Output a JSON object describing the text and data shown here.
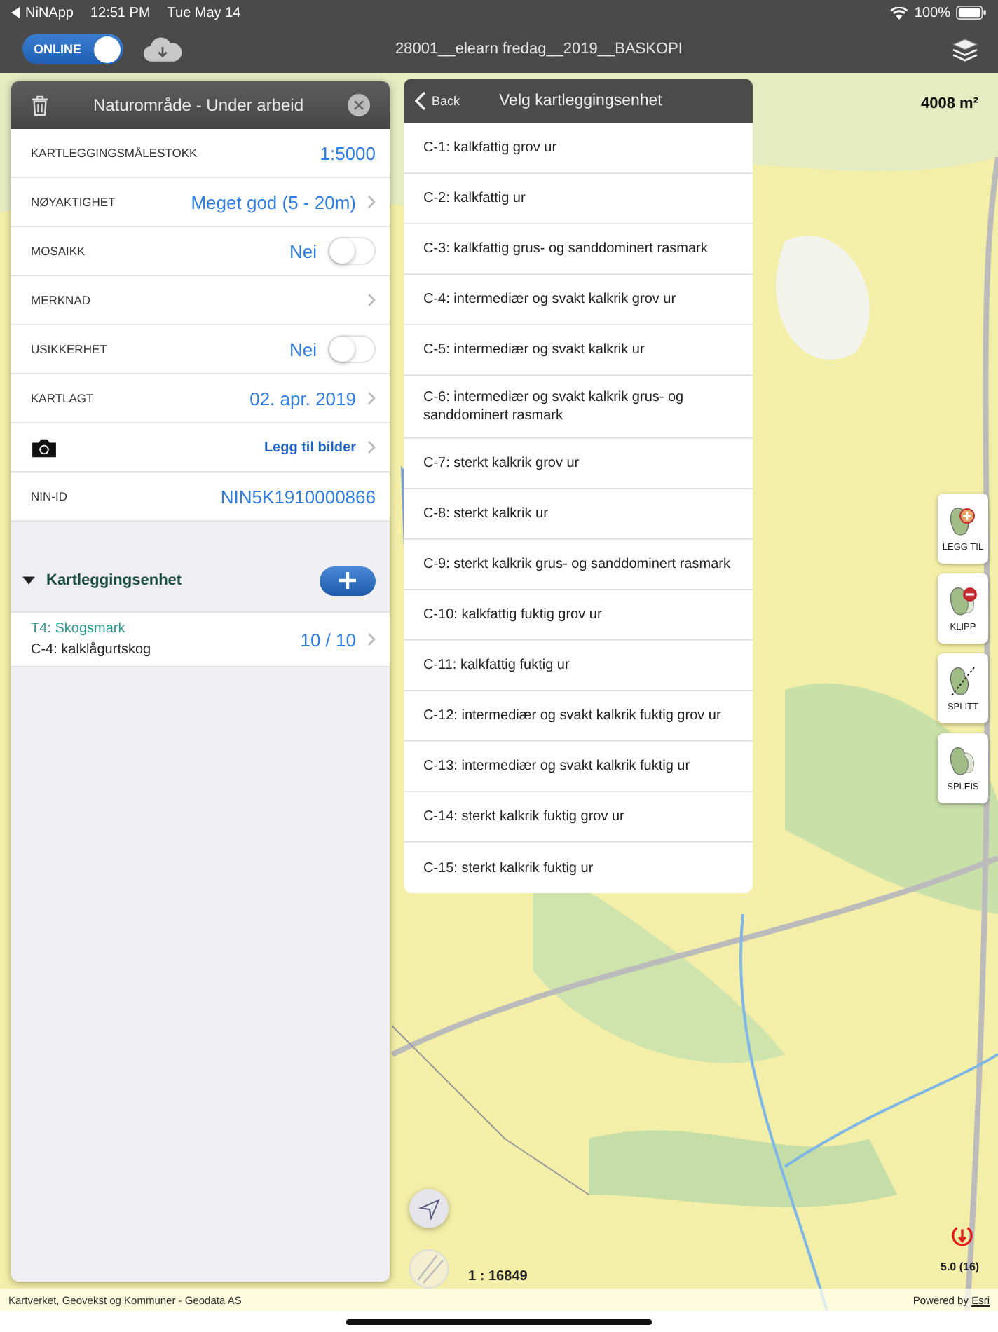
{
  "status_bar": {
    "back_app": "NiNApp",
    "time": "12:51 PM",
    "date": "Tue May 14",
    "battery": "100%"
  },
  "toolbar": {
    "online": {
      "label": "ONLINE",
      "on": true
    },
    "title": "28001__elearn fredag__2019__BASKOPI"
  },
  "area_panel": {
    "title": "Naturområde - Under arbeid",
    "rows": [
      {
        "kind": "value",
        "label": "KARTLEGGINGSMÅLESTOKK",
        "value": "1:5000",
        "chevron": false
      },
      {
        "kind": "value",
        "label": "NØYAKTIGHET",
        "value": "Meget god (5 - 20m)",
        "chevron": true
      },
      {
        "kind": "toggle",
        "label": "MOSAIKK",
        "value": "Nei",
        "on": false
      },
      {
        "kind": "value",
        "label": "MERKNAD",
        "chevron": true
      },
      {
        "kind": "toggle",
        "label": "USIKKERHET",
        "value": "Nei",
        "on": false
      },
      {
        "kind": "value",
        "label": "KARTLAGT",
        "value": "02. apr. 2019",
        "chevron": true
      },
      {
        "value": "Legg til bilder",
        "chevron": true
      },
      {
        "kind": "value",
        "label": "NIN-ID",
        "value": "NIN5K1910000866",
        "chevron": false
      }
    ],
    "section": {
      "title": "Kartleggingsenhet",
      "expanded": true,
      "entries": [
        {
          "type": "T4: Skogsmark",
          "unit": "C-4: kalklågurtskog",
          "count": "10 / 10"
        }
      ]
    }
  },
  "picker": {
    "back": "Back",
    "title": "Velg kartleggingsenhet",
    "items": [
      "C-1: kalkfattig grov ur",
      "C-2: kalkfattig ur",
      "C-3: kalkfattig grus- og sanddominert rasmark",
      "C-4: intermediær og svakt kalkrik grov ur",
      "C-5: intermediær og svakt kalkrik ur",
      "C-6: intermediær og svakt kalkrik grus- og sanddominert rasmark",
      "C-7: sterkt kalkrik grov ur",
      "C-8: sterkt kalkrik ur",
      "C-9: sterkt kalkrik grus- og sanddominert rasmark",
      "C-10: kalkfattig fuktig grov ur",
      "C-11: kalkfattig fuktig ur",
      "C-12: intermediær og svakt kalkrik fuktig grov ur",
      "C-13: intermediær og svakt kalkrik fuktig ur",
      "C-14: sterkt kalkrik fuktig grov ur",
      "C-15: sterkt kalkrik fuktig ur"
    ]
  },
  "map": {
    "area": "4008 m²",
    "tools": [
      {
        "kind": "add",
        "label": "LEGG TIL"
      },
      {
        "kind": "clip",
        "label": "KLIPP"
      },
      {
        "kind": "split",
        "label": "SPLITT"
      },
      {
        "kind": "merge",
        "label": "SPLEIS"
      }
    ],
    "scale": "1 : 16849",
    "accuracy": "5.0 (16)",
    "attribution": "Kartverket, Geovekst og Kommuner - Geodata AS",
    "powered": "Powered by",
    "powered_link": "Esri"
  }
}
